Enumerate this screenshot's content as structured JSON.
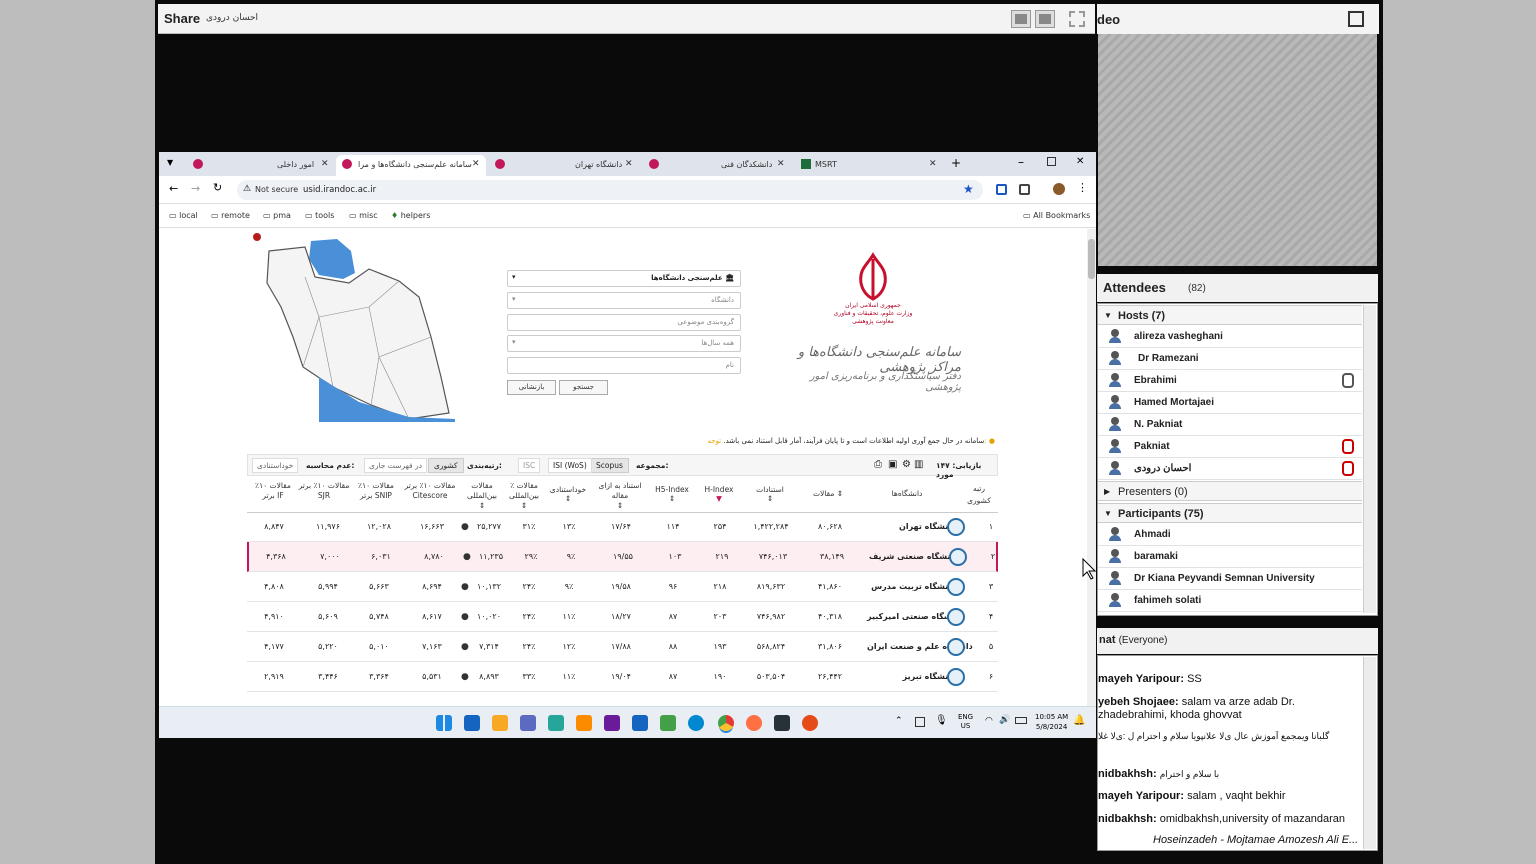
{
  "share": {
    "title": "Share",
    "presenter": "احسان درودی"
  },
  "video": {
    "title": "deo"
  },
  "attendees": {
    "title": "Attendees",
    "count": "(82)",
    "hosts_label": "Hosts (7)",
    "hosts": [
      "alireza vasheghani",
      "Dr Ramezani",
      "Ebrahimi",
      "Hamed Mortajaei",
      "N. Pakniat",
      "Pakniat",
      "احسان درودی"
    ],
    "presenters_label": "Presenters (0)",
    "participants_label": "Participants (75)",
    "participants": [
      "Ahmadi",
      "baramaki",
      "Dr  Kiana Peyvandi Semnan University",
      "fahimeh solati"
    ]
  },
  "chat": {
    "title": "nat",
    "scope": "(Everyone)",
    "messages": [
      {
        "from": "mayeh Yaripour:",
        "text": "SS"
      },
      {
        "from": "yebeh Shojaee:",
        "text": "salam va arze adab Dr."
      },
      {
        "from": "",
        "text": "zhadebrahimi, khoda ghovvat"
      },
      {
        "from": "",
        "text": "گلبانا ویمجمع آموزش عال ی‌لا علانپویا سلام و احترام ل :ی‌لا غلا"
      },
      {
        "from": "nidbakhsh:",
        "text": "با سلام و احترام"
      },
      {
        "from": "mayeh Yaripour:",
        "text": "salam , vaqht bekhir"
      },
      {
        "from": "nidbakhsh:",
        "text": "omidbakhsh,university of mazandaran"
      },
      {
        "from": "",
        "text": "Hoseinzadeh - Mojtamae Amozesh Ali E..."
      }
    ]
  },
  "browser": {
    "tabs": [
      "امور داخلی",
      "سامانه علم‌سنجی دانشگاه‌ها و مرا",
      "دانشگاه تهران",
      "دانشکدگان فنی",
      "MSRT"
    ],
    "not_secure": "Not secure",
    "url": "usid.irandoc.ac.ir",
    "bookmarks": [
      "local",
      "remote",
      "pma",
      "tools",
      "misc",
      "helpers"
    ],
    "all_bookmarks": "All Bookmarks"
  },
  "form": {
    "select1": "علم‌سنجی دانشگاه‌ها",
    "select2": "دانشگاه",
    "field3": "گروه‌بندی موضوعی",
    "select4": "همه سال‌ها",
    "field5": "نام",
    "search": "جستجو",
    "reset": "بازنشانی"
  },
  "brand": {
    "line1": "جمهوری اسلامی ایران",
    "line2": "وزارت علوم، تحقیقات و فناوری",
    "line3": "معاونت پژوهشی",
    "calli1": "سامانه علم‌سنجی دانشگاه‌ها و مراکز پژوهشی",
    "calli2": "دفتر سیاستگذاری و برنامه‌ریزی امور پژوهشی"
  },
  "notice": {
    "label": "توجه:",
    "text": "سامانه در حال جمع آوری اولیه اطلاعات است و تا پایان فرآیند، آمار قابل استناد نمی باشد."
  },
  "filters": {
    "count": "بازیابی: ۱۴۷ مورد",
    "collection": "مجموعه:",
    "coll_opts": [
      "Scopus",
      "ISI (WoS)",
      "ISC"
    ],
    "ranking": "رتبه‌بندی:",
    "rank_opts": [
      "کشوری",
      "در فهرست جاری"
    ],
    "exclude": "عدم محاسبه:",
    "exclude_opt": "خوداستنادی"
  },
  "table": {
    "headers": [
      "رتبه کشوری",
      "دانشگاه‌ها",
      "مقالات",
      "استنادات",
      "H-Index",
      "H5-Index",
      "استناد به ازای مقاله",
      "خوداستنادی",
      "٪ مقالات بین‌المللی",
      "مقالات بین‌المللی",
      "مقالات ۱۰٪ برتر Citescore",
      "مقالات ۱۰٪ برتر SNIP",
      "مقالات ۱۰٪ برتر SJR",
      "مقالات ۱۰٪ برتر IF"
    ],
    "rows": [
      [
        "۱",
        "دانشگاه تهران",
        "۸۰,۶۲۸",
        "۱,۴۲۲,۲۸۴",
        "۲۵۴",
        "۱۱۴",
        "۱۷/۶۴",
        "۱۳٪",
        "۳۱٪",
        "۲۵,۲۷۷",
        "۱۶,۶۶۳",
        "۱۲,۰۲۸",
        "۱۱,۹۷۶",
        "۸,۸۴۷"
      ],
      [
        "۲",
        "دانشگاه صنعتی شریف",
        "۳۸,۱۴۹",
        "۷۴۶,۰۱۳",
        "۲۱۹",
        "۱۰۳",
        "۱۹/۵۵",
        "۹٪",
        "۲۹٪",
        "۱۱,۲۳۵",
        "۸,۷۸۰",
        "۶,۰۳۱",
        "۷,۰۰۰",
        "۴,۳۶۸"
      ],
      [
        "۳",
        "دانشگاه تربیت مدرس",
        "۴۱,۸۶۰",
        "۸۱۹,۶۳۲",
        "۲۱۸",
        "۹۶",
        "۱۹/۵۸",
        "۹٪",
        "۲۴٪",
        "۱۰,۱۳۲",
        "۸,۶۹۴",
        "۵,۶۶۳",
        "۵,۹۹۴",
        "۴,۸۰۸"
      ],
      [
        "۴",
        "دانشگاه صنعتی امیرکبیر",
        "۴۰,۳۱۸",
        "۷۴۶,۹۸۲",
        "۲۰۳",
        "۸۷",
        "۱۸/۲۷",
        "۱۱٪",
        "۲۴٪",
        "۱۰,۰۲۰",
        "۸,۶۱۷",
        "۵,۷۴۸",
        "۵,۶۰۹",
        "۴,۹۱۰"
      ],
      [
        "۵",
        "دانشگاه علم و صنعت ایران",
        "۳۱,۸۰۶",
        "۵۶۸,۸۲۴",
        "۱۹۳",
        "۸۸",
        "۱۷/۸۸",
        "۱۲٪",
        "۲۴٪",
        "۷,۳۱۴",
        "۷,۱۶۳",
        "۵,۰۱۰",
        "۵,۲۲۰",
        "۴,۱۷۷"
      ],
      [
        "۶",
        "دانشگاه تبریز",
        "۲۶,۴۴۲",
        "۵۰۳,۵۰۴",
        "۱۹۰",
        "۸۷",
        "۱۹/۰۴",
        "۱۱٪",
        "۳۳٪",
        "۸,۸۹۳",
        "۵,۵۳۱",
        "۳,۳۶۴",
        "۳,۴۴۶",
        "۲,۹۱۹"
      ]
    ]
  },
  "taskbar": {
    "lang": "ENG",
    "region": "US",
    "time": "10:05 AM",
    "date": "5/8/2024"
  },
  "colors": {
    "accent": "#c2185b",
    "logo_red": "#c8102e",
    "map_water": "#4a90d9"
  }
}
